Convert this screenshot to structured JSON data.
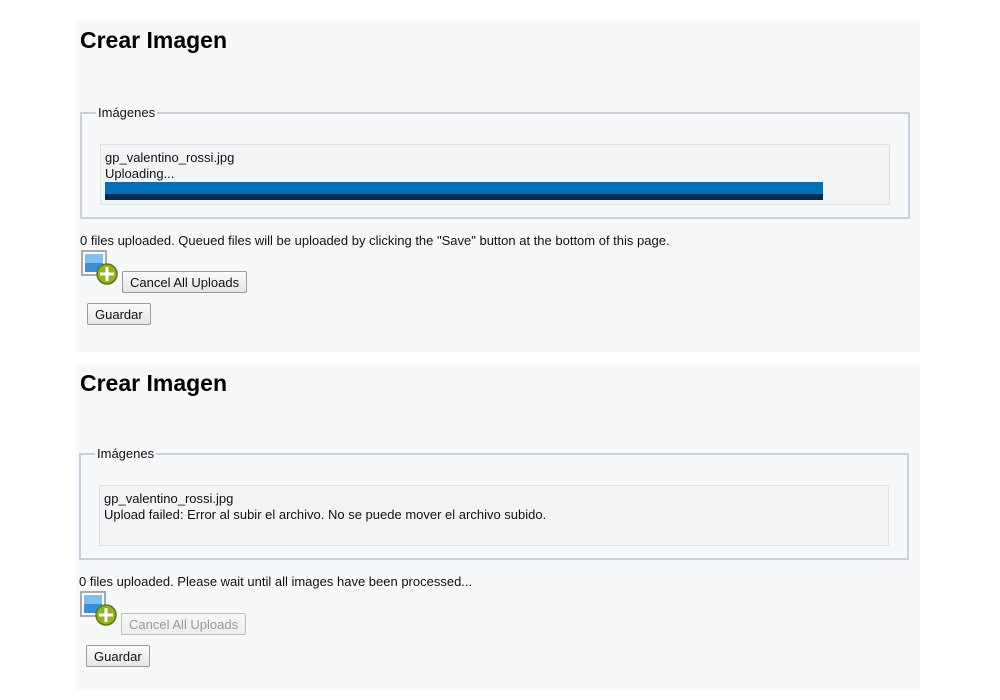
{
  "panels": [
    {
      "title": "Crear Imagen",
      "fieldset_legend": "Imágenes",
      "file": {
        "name": "gp_valentino_rossi.jpg",
        "status": "Uploading...",
        "progress_percent": 100
      },
      "status_text": "0 files uploaded. Queued files will be uploaded by clicking the \"Save\" button at the bottom of this page.",
      "cancel_label": "Cancel All Uploads",
      "cancel_enabled": true,
      "save_label": "Guardar"
    },
    {
      "title": "Crear Imagen",
      "fieldset_legend": "Imágenes",
      "file": {
        "name": "gp_valentino_rossi.jpg",
        "status": "Upload failed: Error al subir el archivo. No se puede mover el archivo subido."
      },
      "status_text": "0 files uploaded. Please wait until all images have been processed...",
      "cancel_label": "Cancel All Uploads",
      "cancel_enabled": false,
      "save_label": "Guardar"
    }
  ],
  "icons": {
    "add_image": "add-image-icon"
  },
  "colors": {
    "panel_bg": "#f7f8fa",
    "progress_fill": "#0070b8",
    "progress_dark": "#002b4f",
    "fieldset_border": "#c8d0de",
    "add_badge": "#8fb51a"
  }
}
